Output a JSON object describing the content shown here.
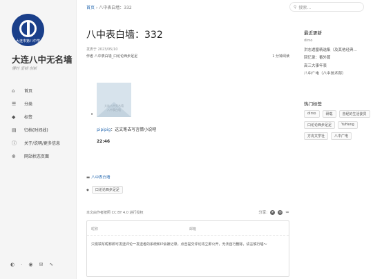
{
  "site": {
    "logo_text": "大连市第八中学",
    "title": "大连八中无名墙",
    "subtitle": "懂时 坚韧 创新"
  },
  "nav": {
    "items": [
      {
        "icon": "home-icon",
        "glyph": "⌂",
        "label": "首页"
      },
      {
        "icon": "list-icon",
        "glyph": "☰",
        "label": "分类"
      },
      {
        "icon": "tag-icon",
        "glyph": "◆",
        "label": "标签"
      },
      {
        "icon": "archive-icon",
        "glyph": "▤",
        "label": "归档(时间线)"
      },
      {
        "icon": "info-icon",
        "glyph": "ⓘ",
        "label": "关于/说明/更多信息"
      },
      {
        "icon": "globe-icon",
        "glyph": "⊕",
        "label": "网站状态页面"
      }
    ],
    "footer_icons": [
      "theme-toggle-icon",
      "github-icon",
      "email-icon",
      "rss-icon"
    ]
  },
  "breadcrumb": {
    "home": "首页",
    "separator": "›",
    "current": "八中表白墙：332"
  },
  "search": {
    "placeholder": "搜索..."
  },
  "post": {
    "title": "八中表白墙：332",
    "published": "发表于 2023/05/10",
    "author": "作者 八中表白墙_口论论西步足足",
    "read_time": "1 分钟阅读",
    "image_text": "大连八中无名墙\n八中表白墙",
    "quote_link": "pipipig",
    "quote_text": "：这文笔去写言情小说吧",
    "time": "22:46",
    "category": "八中表白墙",
    "tag": "口论论西步足足"
  },
  "license": {
    "text": "本文由作者按照 CC BY 4.0 进行授权"
  },
  "share": {
    "label": "分享:"
  },
  "comment": {
    "nick_label": "昵称",
    "mail_label": "邮箱",
    "placeholder": "只需填写昵称即可发送评论一发送者的系统和IP会被记录。点击提交评论将立即公开，无法自行删除，请言慎行喵～"
  },
  "recent": {
    "heading": "最近更新",
    "items": [
      "dimo",
      "洪志透塞精选集（及其他经典...",
      "回忆录：番外篇",
      "高三大事年表",
      "八中广电（八中技术部）"
    ]
  },
  "hot_tags": {
    "heading": "热门标签",
    "items": [
      "dimo",
      "研载",
      "曾经的生活委员",
      "口论论西步足足",
      "YuHeng",
      "方舟文学社",
      "八中广电"
    ]
  }
}
